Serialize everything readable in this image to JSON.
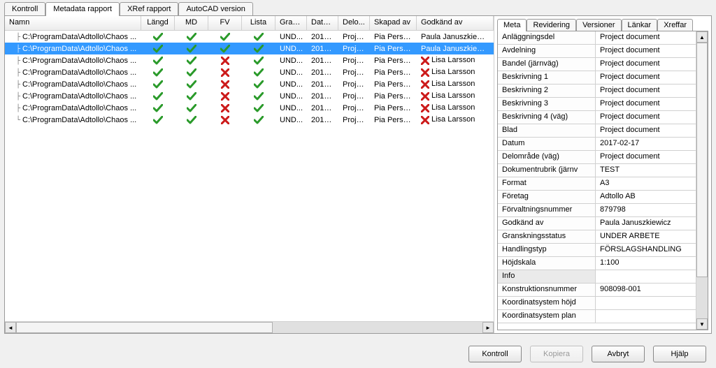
{
  "top_tabs": [
    "Kontroll",
    "Metadata rapport",
    "XRef rapport",
    "AutoCAD version"
  ],
  "top_tab_active": 1,
  "columns": [
    "Namn",
    "Längd",
    "MD",
    "FV",
    "Lista",
    "Gran...",
    "Datum",
    "Delo...",
    "Skapad av",
    "Godkänd av"
  ],
  "rows": [
    {
      "name": "C:\\ProgramData\\Adtollo\\Chaos ...",
      "langd": true,
      "md": true,
      "fv": true,
      "lista": true,
      "gran": "UND...",
      "datum": "2017...",
      "delo": "Proje...",
      "skapad": "Pia Persson",
      "godk": "Paula Januszkiewicz",
      "godk_ok": true,
      "sel": false
    },
    {
      "name": "C:\\ProgramData\\Adtollo\\Chaos ...",
      "langd": true,
      "md": true,
      "fv": true,
      "lista": true,
      "gran": "UND...",
      "datum": "2017...",
      "delo": "Proje...",
      "skapad": "Pia Persson",
      "godk": "Paula Januszkiewicz",
      "godk_ok": true,
      "sel": true
    },
    {
      "name": "C:\\ProgramData\\Adtollo\\Chaos ...",
      "langd": true,
      "md": true,
      "fv": false,
      "lista": true,
      "gran": "UND...",
      "datum": "2017...",
      "delo": "Proje...",
      "skapad": "Pia Persson",
      "godk": "Lisa Larsson",
      "godk_ok": false,
      "sel": false
    },
    {
      "name": "C:\\ProgramData\\Adtollo\\Chaos ...",
      "langd": true,
      "md": true,
      "fv": false,
      "lista": true,
      "gran": "UND...",
      "datum": "2017...",
      "delo": "Proje...",
      "skapad": "Pia Persson",
      "godk": "Lisa Larsson",
      "godk_ok": false,
      "sel": false
    },
    {
      "name": "C:\\ProgramData\\Adtollo\\Chaos ...",
      "langd": true,
      "md": true,
      "fv": false,
      "lista": true,
      "gran": "UND...",
      "datum": "2017...",
      "delo": "Proje...",
      "skapad": "Pia Persson",
      "godk": "Lisa Larsson",
      "godk_ok": false,
      "sel": false
    },
    {
      "name": "C:\\ProgramData\\Adtollo\\Chaos ...",
      "langd": true,
      "md": true,
      "fv": false,
      "lista": true,
      "gran": "UND...",
      "datum": "2017...",
      "delo": "Proje...",
      "skapad": "Pia Persson",
      "godk": "Lisa Larsson",
      "godk_ok": false,
      "sel": false
    },
    {
      "name": "C:\\ProgramData\\Adtollo\\Chaos ...",
      "langd": true,
      "md": true,
      "fv": false,
      "lista": true,
      "gran": "UND...",
      "datum": "2017...",
      "delo": "Proje...",
      "skapad": "Pia Persson",
      "godk": "Lisa Larsson",
      "godk_ok": false,
      "sel": false
    },
    {
      "name": "C:\\ProgramData\\Adtollo\\Chaos ...",
      "langd": true,
      "md": true,
      "fv": false,
      "lista": true,
      "gran": "UND...",
      "datum": "2017...",
      "delo": "Proje...",
      "skapad": "Pia Persson",
      "godk": "Lisa Larsson",
      "godk_ok": false,
      "sel": false
    }
  ],
  "right_tabs": [
    "Meta",
    "Revidering",
    "Versioner",
    "Länkar",
    "Xreffar"
  ],
  "right_tab_active": 0,
  "props": [
    {
      "k": "Anläggningsdel",
      "v": "Project document"
    },
    {
      "k": "Avdelning",
      "v": "Project document"
    },
    {
      "k": "Bandel (järnväg)",
      "v": "Project document"
    },
    {
      "k": "Beskrivning 1",
      "v": "Project document"
    },
    {
      "k": "Beskrivning 2",
      "v": "Project document"
    },
    {
      "k": "Beskrivning 3",
      "v": "Project document"
    },
    {
      "k": "Beskrivning 4 (väg)",
      "v": "Project document"
    },
    {
      "k": "Blad",
      "v": "Project document"
    },
    {
      "k": "Datum",
      "v": "2017-02-17"
    },
    {
      "k": "Delområde (väg)",
      "v": "Project document"
    },
    {
      "k": "Dokumentrubrik (järnv",
      "v": "TEST"
    },
    {
      "k": "Format",
      "v": "A3"
    },
    {
      "k": "Företag",
      "v": "Adtollo AB"
    },
    {
      "k": "Förvaltningsnummer",
      "v": "879798"
    },
    {
      "k": "Godkänd av",
      "v": "Paula Januszkiewicz"
    },
    {
      "k": "Granskningsstatus",
      "v": "UNDER ARBETE"
    },
    {
      "k": "Handlingstyp",
      "v": "FÖRSLAGSHANDLING"
    },
    {
      "k": "Höjdskala",
      "v": "1:100"
    },
    {
      "k": "Info",
      "v": "",
      "sel": true
    },
    {
      "k": "Konstruktionsnummer",
      "v": "908098-001"
    },
    {
      "k": "Koordinatsystem höjd",
      "v": ""
    },
    {
      "k": "Koordinatsystem plan",
      "v": ""
    }
  ],
  "buttons": {
    "kontroll": "Kontroll",
    "kopiera": "Kopiera",
    "avbryt": "Avbryt",
    "hjalp": "Hjälp"
  }
}
